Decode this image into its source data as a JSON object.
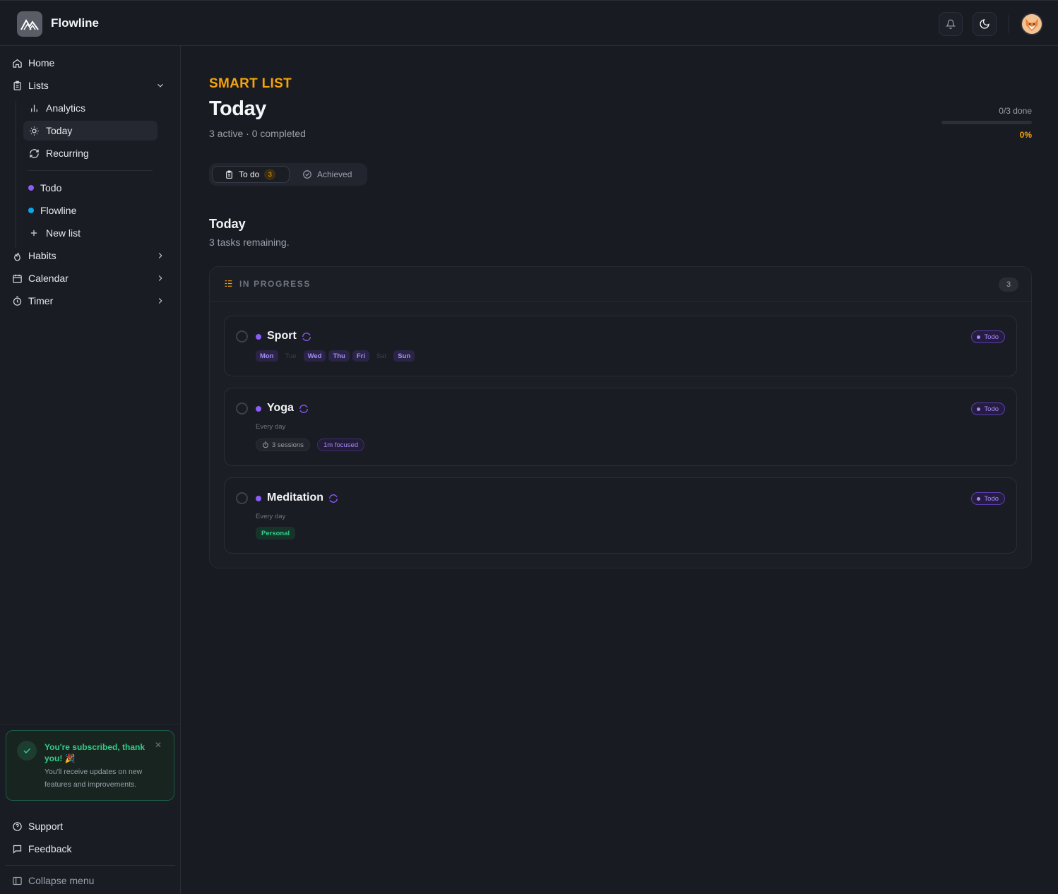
{
  "app": {
    "name": "Flowline"
  },
  "sidebar": {
    "nav": [
      {
        "label": "Home",
        "icon": "home-icon"
      },
      {
        "label": "Lists",
        "icon": "clipboard-icon"
      }
    ],
    "lists_sub": [
      {
        "label": "Analytics",
        "icon": "bar-chart-icon"
      },
      {
        "label": "Today",
        "icon": "sun-icon"
      },
      {
        "label": "Recurring",
        "icon": "refresh-icon"
      }
    ],
    "user_lists": [
      {
        "label": "Todo",
        "color": "#8b5cf6"
      },
      {
        "label": "Flowline",
        "color": "#0ea5e9"
      }
    ],
    "new_list": "New list",
    "sections": [
      {
        "label": "Habits",
        "icon": "flame-icon"
      },
      {
        "label": "Calendar",
        "icon": "calendar-icon"
      },
      {
        "label": "Timer",
        "icon": "stopwatch-icon"
      }
    ],
    "toast": {
      "title": "You're subscribed, thank you! 🎉",
      "body": "You'll receive updates on new features and improvements."
    },
    "footer": {
      "support": "Support",
      "feedback": "Feedback",
      "collapse": "Collapse menu"
    }
  },
  "header": {
    "eyebrow": "SMART LIST",
    "title": "Today",
    "subtitle": "3 active · 0 completed",
    "progress_label": "0/3 done",
    "progress_pct": "0%",
    "progress_value": 0
  },
  "tabs": {
    "todo_label": "To do",
    "todo_count": "3",
    "achieved_label": "Achieved"
  },
  "section": {
    "title": "Today",
    "subtitle": "3 tasks remaining."
  },
  "group": {
    "label": "IN PROGRESS",
    "count": "3"
  },
  "tasks": [
    {
      "name": "Sport",
      "list": "Todo",
      "days": [
        "Mon",
        "Tue",
        "Wed",
        "Thu",
        "Fri",
        "Sat",
        "Sun"
      ],
      "days_active": [
        true,
        false,
        true,
        true,
        true,
        false,
        true
      ]
    },
    {
      "name": "Yoga",
      "list": "Todo",
      "frequency": "Every day",
      "sessions": "3 sessions",
      "focused": "1m focused"
    },
    {
      "name": "Meditation",
      "list": "Todo",
      "frequency": "Every day",
      "tag": "Personal"
    }
  ],
  "colors": {
    "accent": "#f5a30a",
    "purple": "#8b5cf6",
    "green": "#2fcf8a",
    "background": "#181b22"
  }
}
